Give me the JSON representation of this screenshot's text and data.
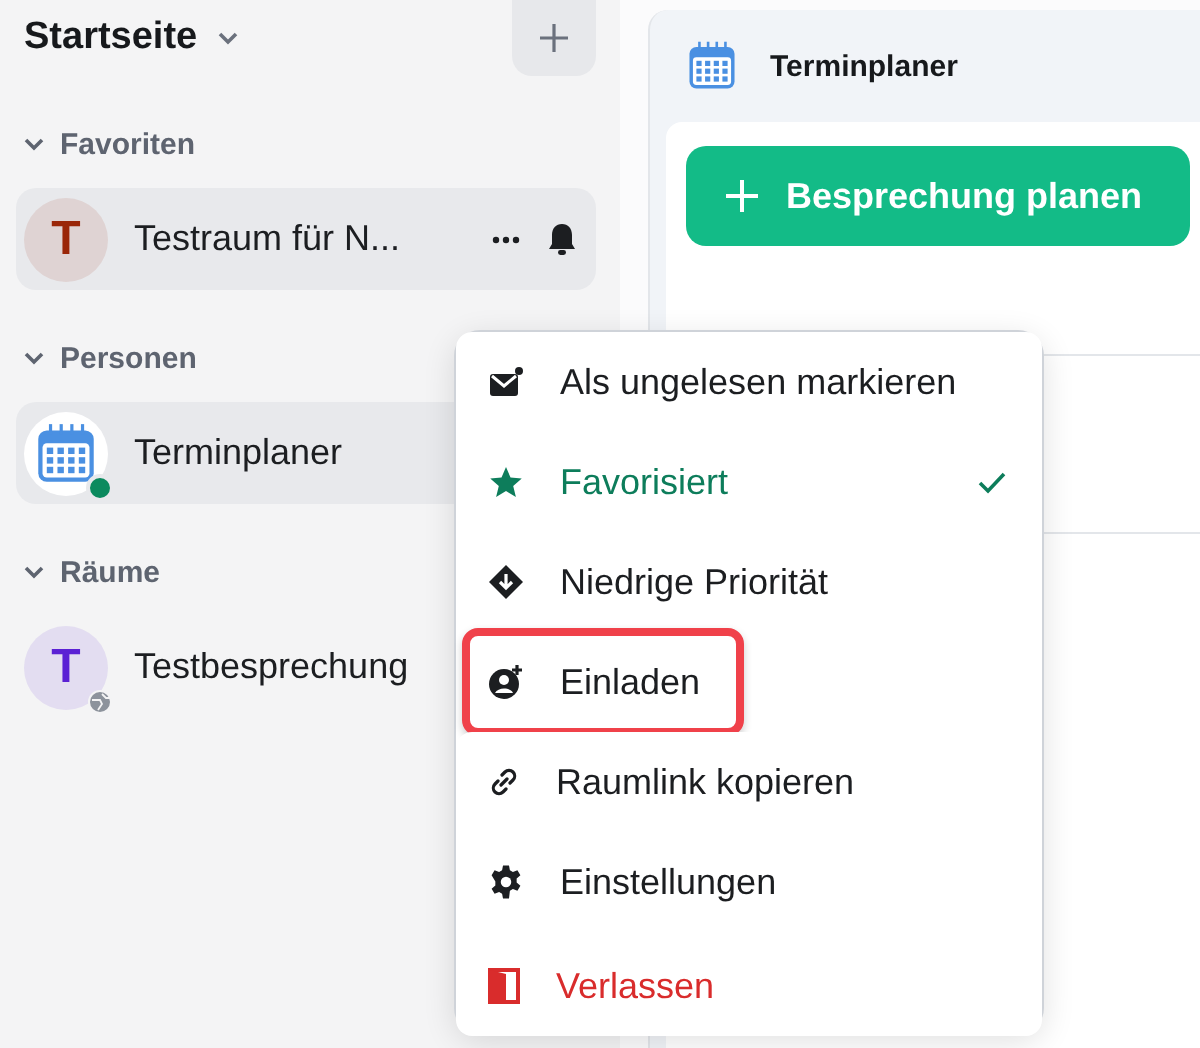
{
  "sidebar": {
    "title": "Startseite",
    "sections": [
      {
        "title": "Favoriten",
        "expanded": true,
        "rooms": [
          {
            "name": "Testraum für N...",
            "avatar": {
              "kind": "letter",
              "letter": "T",
              "color": "#9a2608"
            },
            "selected": true,
            "online": false,
            "public": false,
            "actions": true
          }
        ]
      },
      {
        "title": "Personen",
        "expanded": true,
        "rooms": [
          {
            "name": "Terminplaner",
            "avatar": {
              "kind": "calendar"
            },
            "selected": true,
            "online": true,
            "public": false
          }
        ]
      },
      {
        "title": "Räume",
        "expanded": true,
        "rooms": [
          {
            "name": "Testbesprechung",
            "avatar": {
              "kind": "letter",
              "letter": "T",
              "color": "#5b21d4"
            },
            "selected": false,
            "online": false,
            "public": true
          }
        ]
      }
    ]
  },
  "panel": {
    "title": "Terminplaner",
    "button": "Besprechung planen"
  },
  "context_menu": {
    "items": [
      {
        "label": "Als ungelesen markieren",
        "kind": "mail",
        "highlighted": false
      },
      {
        "label": "Favorisiert",
        "kind": "favourite",
        "checked": true,
        "highlighted": false
      },
      {
        "label": "Niedrige Priorität",
        "kind": "priority",
        "highlighted": false
      },
      {
        "label": "Einladen",
        "kind": "invite",
        "highlighted": true
      },
      {
        "label": "Raumlink kopieren",
        "kind": "link",
        "highlighted": false
      },
      {
        "label": "Einstellungen",
        "kind": "settings",
        "highlighted": false
      },
      {
        "label": "Verlassen",
        "kind": "leave",
        "highlighted": false
      }
    ]
  }
}
